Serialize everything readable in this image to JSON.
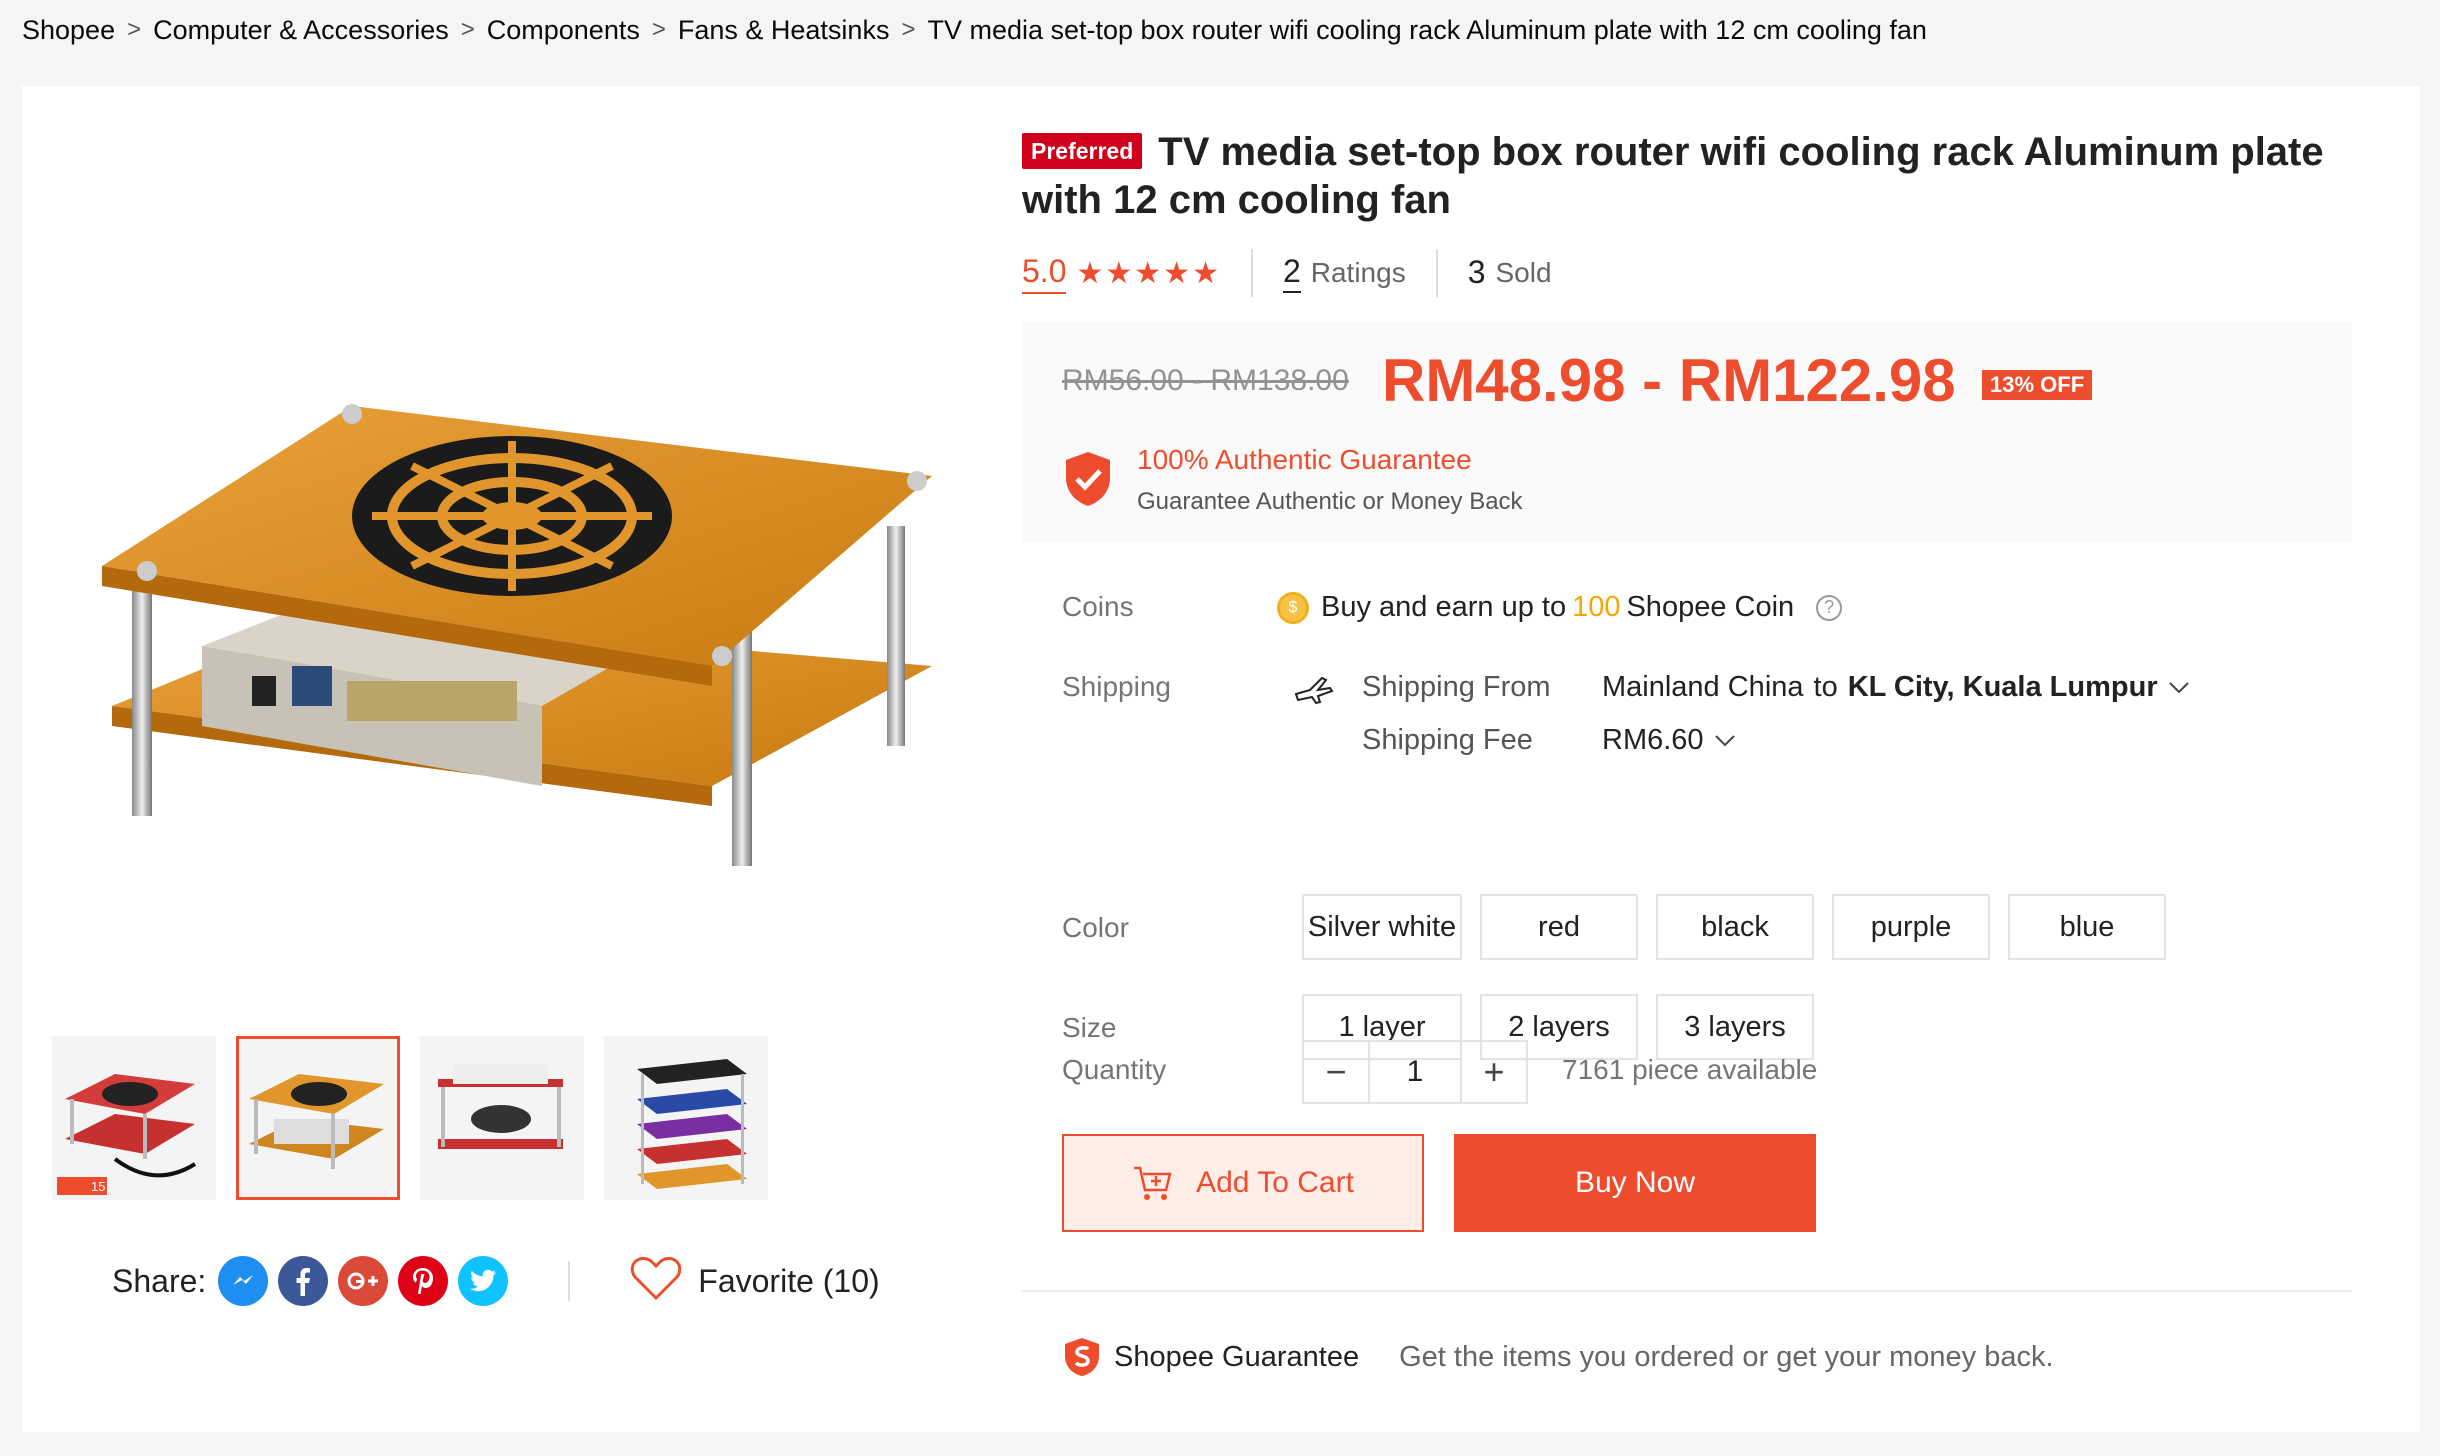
{
  "breadcrumb": {
    "items": [
      "Shopee",
      "Computer & Accessories",
      "Components",
      "Fans & Heatsinks",
      "TV media set-top box router wifi cooling rack Aluminum plate with 12 cm cooling fan"
    ],
    "separator": ">"
  },
  "product": {
    "badge": "Preferred",
    "title": "TV media set-top box router wifi cooling rack Aluminum plate with 12 cm cooling fan",
    "rating": "5.0",
    "stars": "★★★★★",
    "ratings_count": "2",
    "ratings_label": "Ratings",
    "sold_count": "3",
    "sold_label": "Sold"
  },
  "price": {
    "original": "RM56.00 - RM138.00",
    "sale": "RM48.98 - RM122.98",
    "discount": "13% OFF",
    "guarantee_title": "100% Authentic Guarantee",
    "guarantee_sub": "Guarantee Authentic or Money Back"
  },
  "coins": {
    "label": "Coins",
    "prefix": "Buy and earn up to",
    "amount": "100",
    "suffix": "Shopee Coin",
    "help": "?"
  },
  "shipping": {
    "label": "Shipping",
    "from_label": "Shipping From",
    "from": "Mainland China",
    "to_word": "to",
    "destination": "KL City, Kuala Lumpur",
    "fee_label": "Shipping Fee",
    "fee": "RM6.60"
  },
  "color": {
    "label": "Color",
    "options": [
      "Silver white",
      "red",
      "black",
      "purple",
      "blue"
    ]
  },
  "size": {
    "label": "Size",
    "options": [
      "1 layer",
      "2 layers",
      "3 layers"
    ]
  },
  "quantity": {
    "label": "Quantity",
    "minus": "−",
    "value": "1",
    "plus": "+",
    "available": "7161 piece available"
  },
  "actions": {
    "add_to_cart": "Add To Cart",
    "buy_now": "Buy Now"
  },
  "share": {
    "label": "Share:",
    "favorite": "Favorite (10)"
  },
  "thumb_badge": "15",
  "shopee_guarantee": {
    "title": "Shopee Guarantee",
    "desc": "Get the items you ordered or get your money back."
  },
  "colors": {
    "accent": "#ee4d2d",
    "coin": "#f6a700"
  }
}
